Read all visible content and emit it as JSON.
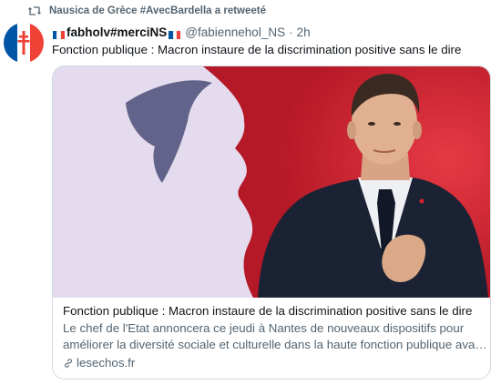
{
  "retweet": {
    "icon": "retweet-icon",
    "text": "Nausica de Grèce #AvecBardella a retweeté"
  },
  "tweet": {
    "avatar_icon": "cross-of-lorraine-icon",
    "display_name": "fabholv#merciNS",
    "handle": "@fabiennehol_NS",
    "separator": "·",
    "time": "2h",
    "text": "Fonction publique : Macron instaure de la discrimination positive sans le dire"
  },
  "card": {
    "image_description_icon": "article-photo",
    "title": "Fonction publique : Macron instaure de la discrimination positive sans le dire",
    "description_line1": "Le chef de l'Etat annoncera ce jeudi à Nantes de nouveaux dispositifs pour",
    "description_line2": "améliorer la diversité sociale et culturelle dans la haute fonction publique ava…",
    "domain_icon": "link-icon",
    "domain": "lesechos.fr"
  },
  "colors": {
    "flag_blue": "#0055a4",
    "flag_white": "#ffffff",
    "flag_red": "#ef4135",
    "secondary_text": "#536471",
    "border": "#cfd9de"
  }
}
